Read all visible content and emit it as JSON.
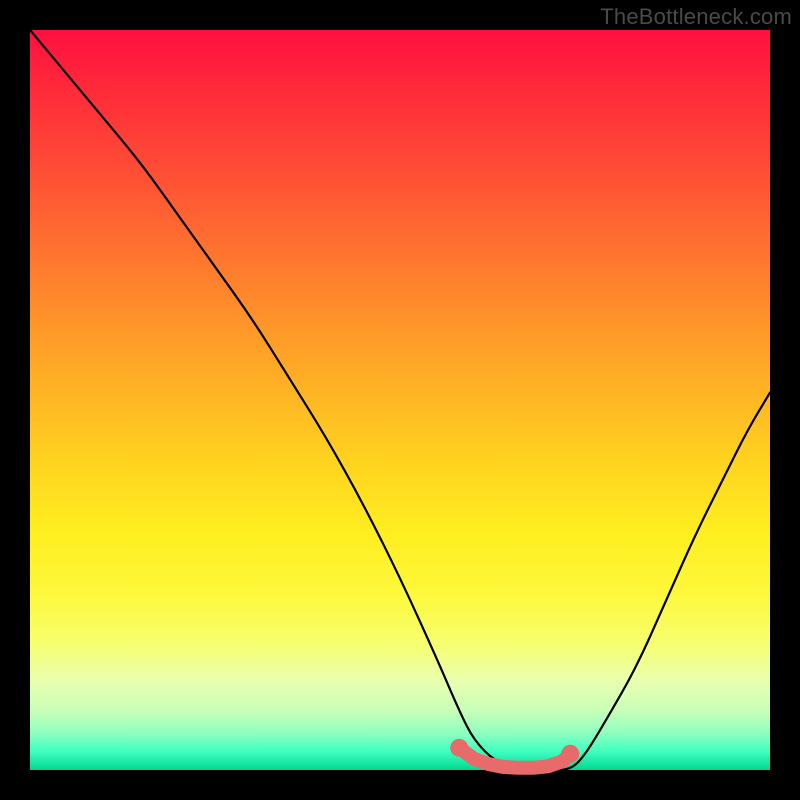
{
  "watermark": "TheBottleneck.com",
  "colors": {
    "frame": "#000000",
    "curve_stroke": "#000000",
    "marker_fill": "#e96a6a",
    "gradient_top": "#ff1040",
    "gradient_bottom": "#00d890"
  },
  "chart_data": {
    "type": "line",
    "title": "",
    "xlabel": "",
    "ylabel": "",
    "xlim": [
      0,
      100
    ],
    "ylim": [
      0,
      100
    ],
    "grid": false,
    "legend": false,
    "series": [
      {
        "name": "bottleneck-curve",
        "x": [
          0,
          5,
          10,
          15,
          20,
          25,
          30,
          35,
          40,
          45,
          50,
          55,
          58,
          60,
          63,
          67,
          70,
          73,
          75,
          78,
          82,
          86,
          90,
          94,
          97,
          100
        ],
        "y": [
          100,
          94,
          88,
          82,
          75,
          68,
          61,
          53,
          45,
          36,
          26,
          15,
          8,
          4,
          1,
          0,
          0,
          0,
          2,
          7,
          14,
          23,
          32,
          40,
          46,
          51
        ]
      }
    ],
    "markers": {
      "name": "optimal-range",
      "x": [
        58,
        60,
        62,
        64,
        66,
        68,
        70,
        72,
        73
      ],
      "y": [
        3,
        1.5,
        0.8,
        0.4,
        0.3,
        0.3,
        0.5,
        1.2,
        2.2
      ]
    }
  }
}
